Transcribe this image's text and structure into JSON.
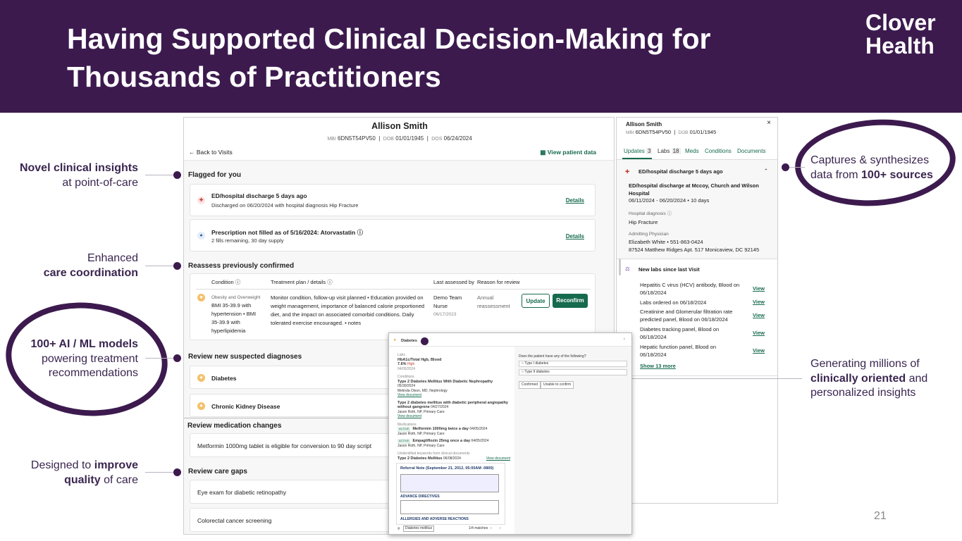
{
  "slide": {
    "title": "Having Supported Clinical Decision-Making for Thousands of Practitioners",
    "logo_line1": "Clover",
    "logo_line2": "Health",
    "page_number": "21"
  },
  "callouts": {
    "c1_line1": "Novel clinical insights",
    "c1_line2": "at point-of-care",
    "c2_line1": "Enhanced",
    "c2_line2": "care coordination",
    "c3_line1": "100+ AI / ML models",
    "c3_line2": "powering treatment",
    "c3_line3": "recommendations",
    "c4_pre": "Designed to ",
    "c4_bold1": "improve",
    "c4_bold2": "quality",
    "c4_post": " of care",
    "r1_line1": "Captures & synthesizes",
    "r1_pre": "data from ",
    "r1_bold": "100+ sources",
    "r2_line1": "Generating millions of",
    "r2_bold": "clinically oriented",
    "r2_post": " and",
    "r2_line3": "personalized insights"
  },
  "patient": {
    "name": "Allison Smith",
    "mbi_label": "MBI",
    "mbi": "6DN5T54PV50",
    "dob_label": "DOB",
    "dob": "01/01/1945",
    "dos_label": "DOS",
    "dos": "06/24/2024",
    "back": "Back to Visits",
    "view_patient": "View patient data"
  },
  "flagged": {
    "heading": "Flagged for you",
    "item1_title": "ED/hospital discharge 5 days ago",
    "item1_sub": "Discharged on 06/20/2024 with hospital diagnosis Hip Fracture",
    "item1_link": "Details",
    "item2_title": "Prescription not filled as of 5/16/2024: Atorvastatin",
    "item2_sub": "2 fills remaining, 30 day supply",
    "item2_link": "Details"
  },
  "reassess": {
    "heading": "Reassess previously confirmed",
    "col_condition": "Condition",
    "col_treatment": "Treatment plan / details",
    "col_last": "Last assessed by",
    "col_reason": "Reason for review",
    "cond_label": "Obesity and Overweight",
    "cond_text": [
      "BMI 35-39.9 with",
      "hypertension • BMI",
      "35-39.9 with",
      "hyperlipidemia"
    ],
    "treatment": [
      "Monitor condition, follow-up visit planned • Education provided on",
      "weight management, importance of balanced calorie proportioned",
      "diet, and the impact on associated comorbid conditions. Daily",
      "tolerated exercise encouraged. • notes"
    ],
    "assessor1": "Demo Team",
    "assessor2": "Nurse",
    "assessed_date": "06/17/2023",
    "reason1": "Annual",
    "reason2": "reassessment",
    "update": "Update",
    "reconfirm": "Reconfirm"
  },
  "suspected": {
    "heading": "Review new suspected diagnoses",
    "item1": "Diabetes",
    "item2": "Chronic Kidney Disease"
  },
  "meds": {
    "heading": "Review medication changes",
    "item1": "Metformin 1000mg tablet is eligible for conversion to 90 day script"
  },
  "gaps": {
    "heading": "Review care gaps",
    "item1": "Eye exam for diabetic retinopathy",
    "item2": "Colorectal cancer screening"
  },
  "right": {
    "name": "Allison Smith",
    "mbi_label": "MBI",
    "mbi": "6DN5T54PV50",
    "dob_label": "DOB",
    "dob": "01/01/1945",
    "tab_updates": "Updates",
    "tab_updates_count": "3",
    "tab_labs": "Labs",
    "tab_labs_count": "18",
    "tab_meds": "Meds",
    "tab_conditions": "Conditions",
    "tab_documents": "Documents",
    "ed_heading": "ED/hospital discharge 5 days ago",
    "ed_place1": "ED/hospital discharge at Mccoy, Church and Wilson",
    "ed_place2": "Hospital",
    "ed_dates": "06/11/2024 - 06/20/2024 • 10 days",
    "dx_label": "Hospital diagnosis",
    "dx": "Hip Fracture",
    "phys_label": "Admitting Physician",
    "phys": "Elizabeth White • 551-863-0424",
    "addr": "87524 Matthew Ridges Apt. 517 Monicaview, DC 92145",
    "labs_heading": "New labs since last Visit",
    "lab1a": "Hepatitis C virus (HCV) antibody, Blood on",
    "lab1b": "06/18/2024",
    "lab2": "Labs ordered on 06/18/2024",
    "lab3a": "Creatinine and Glomerular filtration rate",
    "lab3b": "predicted panel, Blood on 06/18/2024",
    "lab4a": "Diabetes tracking panel, Blood on",
    "lab4b": "06/18/2024",
    "lab5a": "Hepatic function panel, Blood on",
    "lab5b": "06/18/2024",
    "view": "View",
    "show_more": "Show 13 more"
  },
  "popup": {
    "title": "Diabetes",
    "labs_label": "Labs",
    "lab_name": "HbA1c/Total Hgb, Blood",
    "lab_value": "7.6%",
    "lab_flag": "High",
    "lab_date": "04/05/2024",
    "conditions_label": "Conditions",
    "cond1": "Type 2 Diabetes Mellitus With Diabetic Nephropathy",
    "cond1_date": "05/30/2024",
    "cond1_by": "Melinda Olson, MD, Nephrology",
    "view_doc": "View document",
    "cond2a": "Type 2 diabetes mellitus with diabetic peripheral angiopathy",
    "cond2b": "without gangrene",
    "cond2_date": "04/27/2024",
    "cond2_by": "Jason Roth, NP, Primary Care",
    "meds_label": "Medications",
    "active": "ACTIVE",
    "med1": "Metformin 1000mg twice a day",
    "med1_date": "04/05/2024",
    "med1_by": "Jason Roth, NP, Primary Care",
    "med2": "Empagliflozin 25mg once a day",
    "med2_date": "04/05/2024",
    "med2_by": "Jason Roth, NP, Primary Care",
    "kw_label": "Unidentified keywords from clinical documents",
    "kw_item": "Type 2 Diabetes Mellitus",
    "kw_date": "06/08/2024",
    "note_title": "Referral Note (September 21, 2012, 05:00AM -0800)",
    "advance": "ADVANCE DIRECTIVES",
    "allergies": "ALLERGIES AND ADVERSE REACTIONS",
    "search_value": "Diabetes mellitus",
    "matches": "1/4 matches",
    "question": "Does the patient have any of the following?",
    "opt1": "Type I diabetes",
    "opt2": "Type II diabetes",
    "confirmed": "Confirmed",
    "unable": "Unable to confirm"
  }
}
